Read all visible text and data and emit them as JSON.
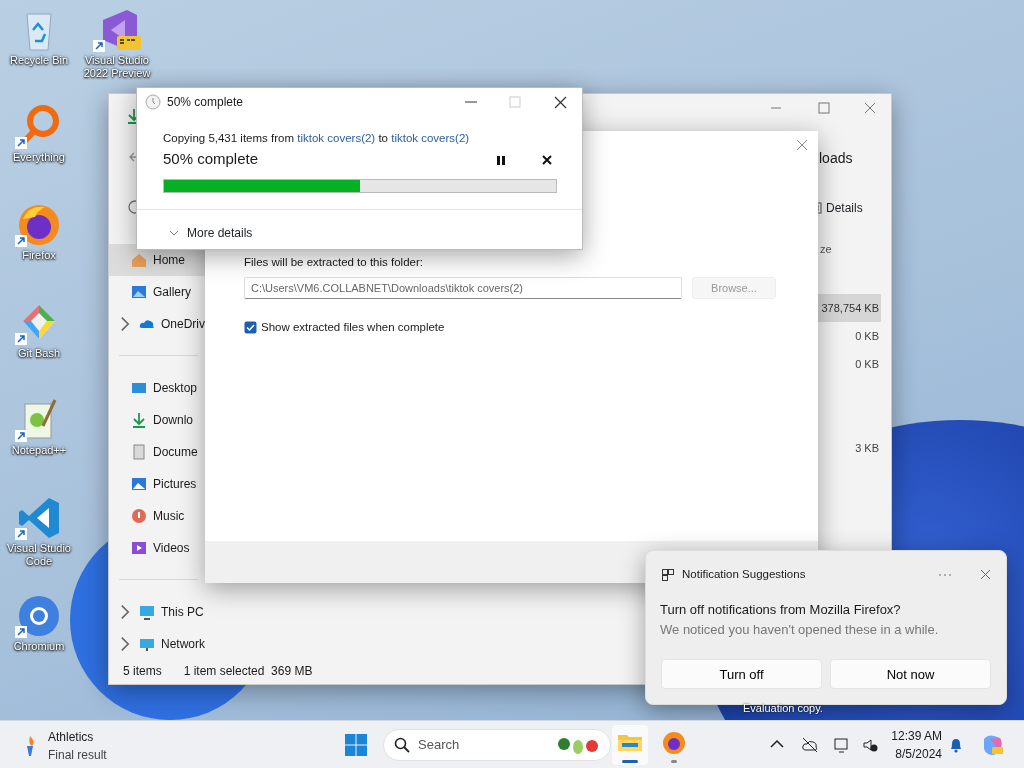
{
  "desktop_icons": [
    {
      "label": "Recycle Bin",
      "kind": "bin"
    },
    {
      "label": "Visual Studio 2022 Preview",
      "kind": "vspre"
    },
    {
      "label": "Everything",
      "kind": "search"
    },
    {
      "label": "Firefox",
      "kind": "firefox"
    },
    {
      "label": "Git Bash",
      "kind": "git"
    },
    {
      "label": "Notepad++",
      "kind": "notepad"
    },
    {
      "label": "Visual Studio Code",
      "kind": "vscode"
    },
    {
      "label": "Chromium",
      "kind": "chromium"
    }
  ],
  "explorer": {
    "title_partial": "loads",
    "view_button": "Details",
    "column_partial": "ze",
    "nav": [
      {
        "label": "Home",
        "kind": "home",
        "selected": true,
        "expandable": false
      },
      {
        "label": "Gallery",
        "kind": "gallery",
        "selected": false,
        "expandable": false
      },
      {
        "label": "OneDriv",
        "kind": "cloud",
        "selected": false,
        "expandable": true
      },
      {
        "kind": "separator"
      },
      {
        "label": "Desktop",
        "kind": "desktop",
        "selected": false,
        "expandable": false
      },
      {
        "label": "Downlo",
        "kind": "download",
        "selected": false,
        "expandable": false
      },
      {
        "label": "Docume",
        "kind": "document",
        "selected": false,
        "expandable": false
      },
      {
        "label": "Pictures",
        "kind": "pictures",
        "selected": false,
        "expandable": false
      },
      {
        "label": "Music",
        "kind": "music",
        "selected": false,
        "expandable": false
      },
      {
        "label": "Videos",
        "kind": "videos",
        "selected": false,
        "expandable": false
      },
      {
        "kind": "separator"
      },
      {
        "label": "This PC",
        "kind": "pc",
        "selected": false,
        "expandable": true
      },
      {
        "label": "Network",
        "kind": "network",
        "selected": false,
        "expandable": true
      }
    ],
    "sizes": [
      {
        "kind": "size",
        "text": "378,754 KB",
        "selected": true
      },
      {
        "kind": "size",
        "text": "0 KB",
        "selected": false
      },
      {
        "kind": "size",
        "text": "0 KB",
        "selected": false
      },
      {
        "kind": "spacer"
      },
      {
        "kind": "spacer"
      },
      {
        "kind": "size",
        "text": "3 KB",
        "selected": false
      }
    ],
    "status_items": "5 items",
    "status_selection": "1 item selected  369 MB"
  },
  "extract_dialog": {
    "folder_label": "Files will be extracted to this folder:",
    "path": "C:\\Users\\VM6.COLLABNET\\Downloads\\tiktok covers(2)",
    "browse": "Browse...",
    "browse_disabled": true,
    "option": {
      "label": "Show extracted files when complete",
      "checked": true
    }
  },
  "copy_dialog": {
    "title": "50% complete",
    "prefix": "Copying 5,431 items from ",
    "source": "tiktok covers(2)",
    "middle": " to ",
    "destination": "tiktok covers(2)",
    "heading": "50% complete",
    "level": 0.5,
    "more_details": "More details"
  },
  "notification": {
    "app": "Notification Suggestions",
    "title": "Turn off notifications from Mozilla Firefox?",
    "body": "We noticed you haven't opened these in a while.",
    "buttons": [
      "Turn off",
      "Not now"
    ]
  },
  "watermark_text": "Evaluation copy.",
  "taskbar": {
    "widget_title": "Athletics",
    "widget_subtitle": "Final result",
    "search_placeholder": "Search",
    "apps": [
      {
        "kind": "explorer",
        "active": true
      },
      {
        "kind": "firefox",
        "active": false
      }
    ],
    "time": "12:39 AM",
    "date": "8/5/2024"
  }
}
